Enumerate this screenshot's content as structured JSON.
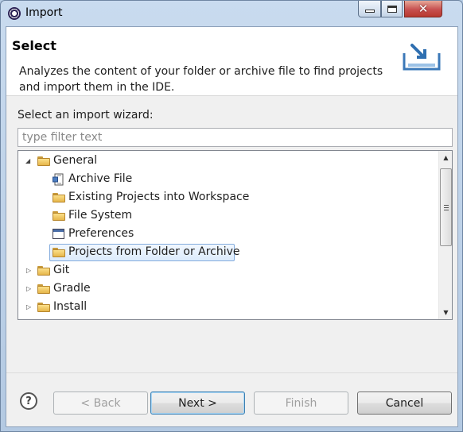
{
  "window": {
    "title": "Import",
    "controls": {
      "minimize_icon": "minimize-icon",
      "maximize_icon": "maximize-icon",
      "close_icon": "close-icon",
      "close_glyph": "✕"
    }
  },
  "banner": {
    "title": "Select",
    "description": "Analyzes the content of your folder or archive file to find projects and import them in the IDE.",
    "icon": "import-tray-icon"
  },
  "wizard": {
    "label": "Select an import wizard:",
    "filter_placeholder": "type filter text",
    "filter_value": ""
  },
  "tree": {
    "items": [
      {
        "label": "General",
        "expanded": true,
        "icon": "folder-icon"
      },
      {
        "label": "Archive File",
        "icon": "archive-file-icon"
      },
      {
        "label": "Existing Projects into Workspace",
        "icon": "existing-projects-icon"
      },
      {
        "label": "File System",
        "icon": "folder-icon"
      },
      {
        "label": "Preferences",
        "icon": "preferences-icon"
      },
      {
        "label": "Projects from Folder or Archive",
        "icon": "folder-icon",
        "selected": true
      },
      {
        "label": "Git",
        "expanded": false,
        "icon": "folder-icon"
      },
      {
        "label": "Gradle",
        "expanded": false,
        "icon": "folder-icon"
      },
      {
        "label": "Install",
        "expanded": false,
        "icon": "folder-icon"
      }
    ]
  },
  "buttons": {
    "help": "?",
    "back": "< Back",
    "next": "Next >",
    "finish": "Finish",
    "cancel": "Cancel"
  },
  "colors": {
    "selection_border": "#84acdd",
    "selection_fill": "#dcebfc",
    "default_button_border": "#3c7fb1"
  }
}
